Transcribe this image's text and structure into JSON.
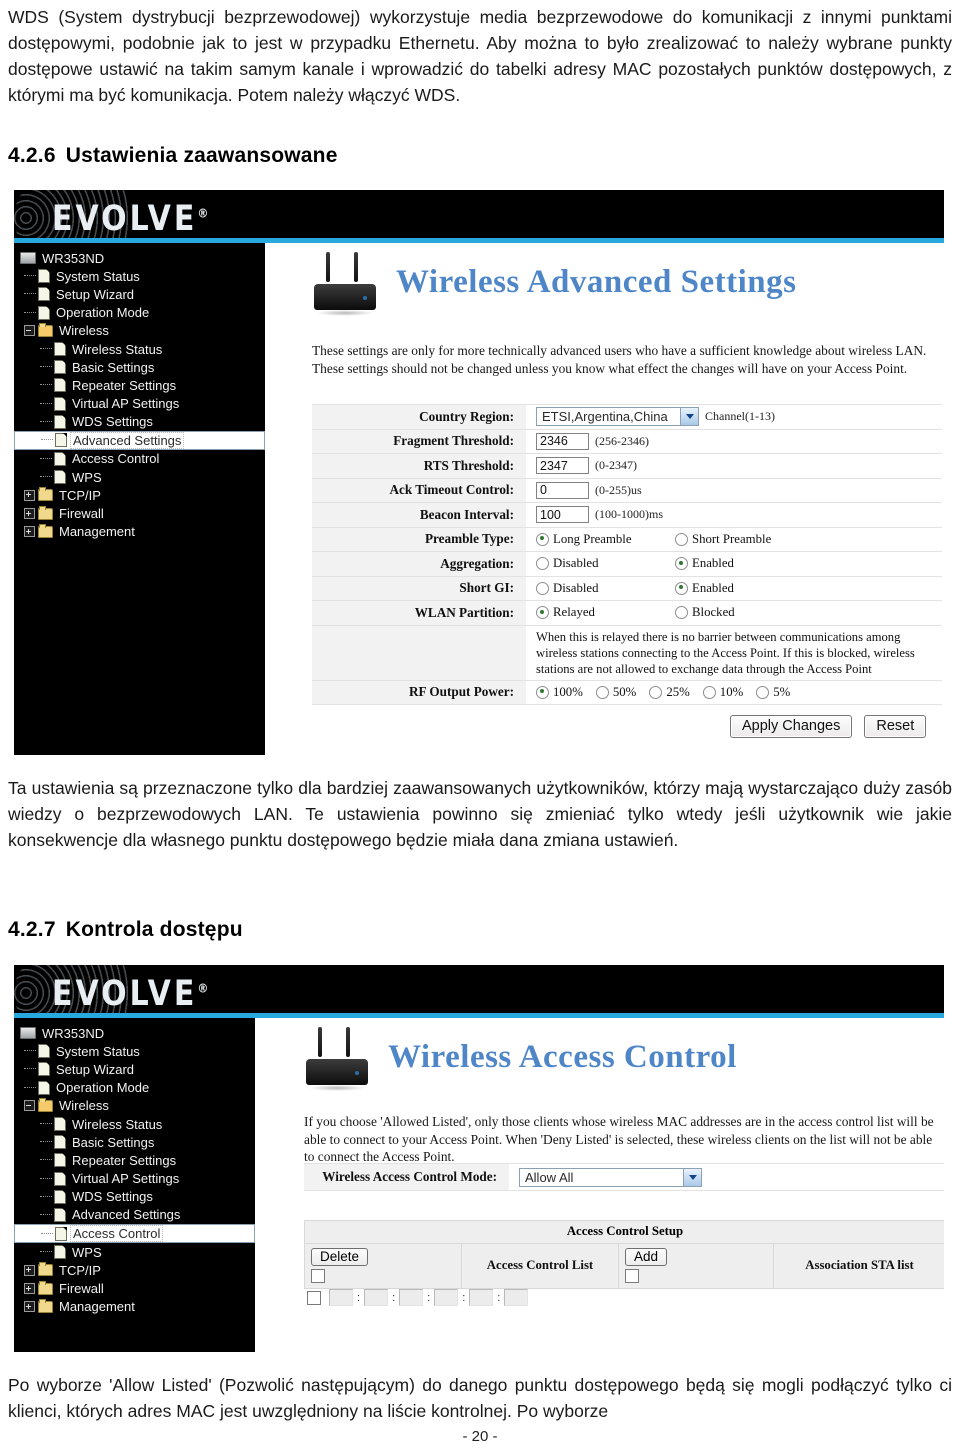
{
  "document": {
    "intro_paragraph": "WDS (System dystrybucji bezprzewodowej) wykorzystuje media bezprzewodowe do komunikacji z innymi punktami dostępowymi, podobnie jak to jest w przypadku Ethernetu. Aby można to było zrealizować to należy wybrane punkty dostępowe ustawić na takim samym kanale i wprowadzić do tabelki adresy MAC pozostałych punktów dostępowych, z którymi ma być komunikacja. Potem należy włączyć WDS.",
    "section_426_number": "4.2.6",
    "section_426_title": "Ustawienia zaawansowane",
    "middle_paragraph": "Ta ustawienia są przeznaczone tylko dla bardziej zaawansowanych użytkowników, którzy mają wystarczająco duży zasób wiedzy o bezprzewodowych LAN. Te ustawienia powinno się zmieniać tylko wtedy jeśli użytkownik wie jakie konsekwencje dla własnego punktu dostępowego będzie miała dana zmiana ustawień.",
    "section_427_number": "4.2.7",
    "section_427_title": "Kontrola dostępu",
    "closing_paragraph": "Po wyborze 'Allow Listed' (Pozwolić następującym) do danego punktu dostępowego będą się mogli podłączyć tylko ci klienci, których adres MAC jest uwzględniony na liście kontrolnej. Po wyborze",
    "page_number": "- 20 -"
  },
  "brand": {
    "logo_text": "EVOLVE",
    "logo_registered": "®",
    "accent_color": "#27a8de",
    "title_color": "#4e86c8"
  },
  "screenshot_advanced": {
    "sidebar": {
      "root_label": "WR353ND",
      "items": [
        {
          "label": "System Status",
          "level": 1,
          "icon": "page-icon",
          "selected": false
        },
        {
          "label": "Setup Wizard",
          "level": 1,
          "icon": "page-icon",
          "selected": false
        },
        {
          "label": "Operation Mode",
          "level": 1,
          "icon": "page-icon",
          "selected": false
        },
        {
          "label": "Wireless",
          "level": 1,
          "icon": "folder-open-icon",
          "selected": false,
          "expander": "minus"
        },
        {
          "label": "Wireless Status",
          "level": 2,
          "icon": "page-icon",
          "selected": false
        },
        {
          "label": "Basic Settings",
          "level": 2,
          "icon": "page-icon",
          "selected": false
        },
        {
          "label": "Repeater Settings",
          "level": 2,
          "icon": "page-icon",
          "selected": false
        },
        {
          "label": "Virtual AP Settings",
          "level": 2,
          "icon": "page-icon",
          "selected": false
        },
        {
          "label": "WDS Settings",
          "level": 2,
          "icon": "page-icon",
          "selected": false
        },
        {
          "label": "Advanced Settings",
          "level": 2,
          "icon": "page-icon",
          "selected": true
        },
        {
          "label": "Access Control",
          "level": 2,
          "icon": "page-icon",
          "selected": false
        },
        {
          "label": "WPS",
          "level": 2,
          "icon": "page-icon",
          "selected": false
        },
        {
          "label": "TCP/IP",
          "level": 1,
          "icon": "folder-icon",
          "selected": false,
          "expander": "plus"
        },
        {
          "label": "Firewall",
          "level": 1,
          "icon": "folder-icon",
          "selected": false,
          "expander": "plus"
        },
        {
          "label": "Management",
          "level": 1,
          "icon": "folder-icon",
          "selected": false,
          "expander": "plus"
        }
      ]
    },
    "page_title": "Wireless Advanced Settings",
    "description": "These settings are only for more technically advanced users who have a sufficient knowledge about wireless LAN. These settings should not be changed unless you know what effect the changes will have on your Access Point.",
    "fields": {
      "country_region_label": "Country Region:",
      "country_region_value": "ETSI,Argentina,China",
      "country_region_hint": "Channel(1-13)",
      "fragment_threshold_label": "Fragment Threshold:",
      "fragment_threshold_value": "2346",
      "fragment_threshold_hint": "(256-2346)",
      "rts_threshold_label": "RTS Threshold:",
      "rts_threshold_value": "2347",
      "rts_threshold_hint": "(0-2347)",
      "ack_timeout_label": "Ack Timeout Control:",
      "ack_timeout_value": "0",
      "ack_timeout_hint": "(0-255)us",
      "beacon_interval_label": "Beacon Interval:",
      "beacon_interval_value": "100",
      "beacon_interval_hint": "(100-1000)ms",
      "preamble_label": "Preamble Type:",
      "preamble_opt1": "Long Preamble",
      "preamble_opt2": "Short Preamble",
      "aggregation_label": "Aggregation:",
      "aggregation_opt1": "Disabled",
      "aggregation_opt2": "Enabled",
      "shortgi_label": "Short GI:",
      "shortgi_opt1": "Disabled",
      "shortgi_opt2": "Enabled",
      "wlan_partition_label": "WLAN Partition:",
      "wlan_partition_opt1": "Relayed",
      "wlan_partition_opt2": "Blocked",
      "wlan_partition_note": "When this is relayed there is no barrier between communications among wireless stations connecting to the Access Point. If this is blocked, wireless stations are not allowed to exchange data through the Access Point",
      "rf_power_label": "RF Output Power:",
      "rf_power_opt1": "100%",
      "rf_power_opt2": "50%",
      "rf_power_opt3": "25%",
      "rf_power_opt4": "10%",
      "rf_power_opt5": "5%"
    },
    "buttons": {
      "apply_label": "Apply Changes",
      "reset_label": "Reset"
    }
  },
  "screenshot_access_control": {
    "sidebar": {
      "root_label": "WR353ND",
      "items": [
        {
          "label": "System Status",
          "level": 1,
          "icon": "page-icon",
          "selected": false
        },
        {
          "label": "Setup Wizard",
          "level": 1,
          "icon": "page-icon",
          "selected": false
        },
        {
          "label": "Operation Mode",
          "level": 1,
          "icon": "page-icon",
          "selected": false
        },
        {
          "label": "Wireless",
          "level": 1,
          "icon": "folder-open-icon",
          "selected": false,
          "expander": "minus"
        },
        {
          "label": "Wireless Status",
          "level": 2,
          "icon": "page-icon",
          "selected": false
        },
        {
          "label": "Basic Settings",
          "level": 2,
          "icon": "page-icon",
          "selected": false
        },
        {
          "label": "Repeater Settings",
          "level": 2,
          "icon": "page-icon",
          "selected": false
        },
        {
          "label": "Virtual AP Settings",
          "level": 2,
          "icon": "page-icon",
          "selected": false
        },
        {
          "label": "WDS Settings",
          "level": 2,
          "icon": "page-icon",
          "selected": false
        },
        {
          "label": "Advanced Settings",
          "level": 2,
          "icon": "page-icon",
          "selected": false
        },
        {
          "label": "Access Control",
          "level": 2,
          "icon": "page-icon",
          "selected": true
        },
        {
          "label": "WPS",
          "level": 2,
          "icon": "page-icon",
          "selected": false
        },
        {
          "label": "TCP/IP",
          "level": 1,
          "icon": "folder-icon",
          "selected": false,
          "expander": "plus"
        },
        {
          "label": "Firewall",
          "level": 1,
          "icon": "folder-icon",
          "selected": false,
          "expander": "plus"
        },
        {
          "label": "Management",
          "level": 1,
          "icon": "folder-icon",
          "selected": false,
          "expander": "plus"
        }
      ]
    },
    "page_title": "Wireless Access Control",
    "description": "If you choose 'Allowed Listed', only those clients whose wireless MAC addresses are in the access control list will be able to connect to your Access Point. When 'Deny Listed' is selected, these wireless clients on the list will not be able to connect the Access Point.",
    "mode_label": "Wireless Access Control Mode:",
    "mode_value": "Allow All",
    "table": {
      "header": "Access Control Setup",
      "delete_button": "Delete",
      "list_column": "Access Control List",
      "add_button": "Add",
      "sta_column": "Association STA list"
    }
  }
}
